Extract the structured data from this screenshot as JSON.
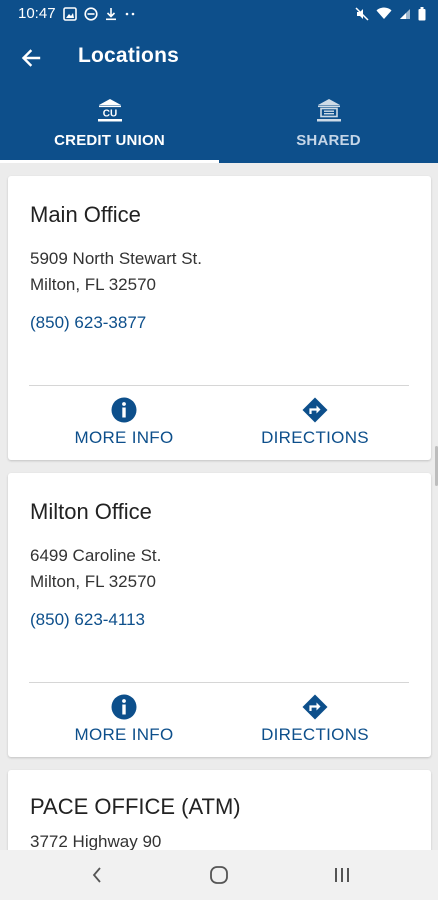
{
  "status_bar": {
    "time": "10:47"
  },
  "app_bar": {
    "title": "Locations"
  },
  "tabs": [
    {
      "label": "CREDIT UNION",
      "icon": "credit-union-icon",
      "selected": true
    },
    {
      "label": "SHARED",
      "icon": "bank-icon",
      "selected": false
    }
  ],
  "locations": [
    {
      "name": "Main Office",
      "address_line1": "5909 North Stewart St.",
      "address_line2": "Milton, FL 32570",
      "phone": "(850) 623-3877",
      "more_info_label": "MORE INFO",
      "directions_label": "DIRECTIONS"
    },
    {
      "name": "Milton Office",
      "address_line1": "6499 Caroline St.",
      "address_line2": "Milton, FL 32570",
      "phone": "(850) 623-4113",
      "more_info_label": "MORE INFO",
      "directions_label": "DIRECTIONS"
    },
    {
      "name": "PACE OFFICE (ATM)",
      "address_line1": "3772 Highway 90"
    }
  ],
  "colors": {
    "primary": "#0d4f8b",
    "background": "#ececec",
    "card": "#ffffff"
  }
}
